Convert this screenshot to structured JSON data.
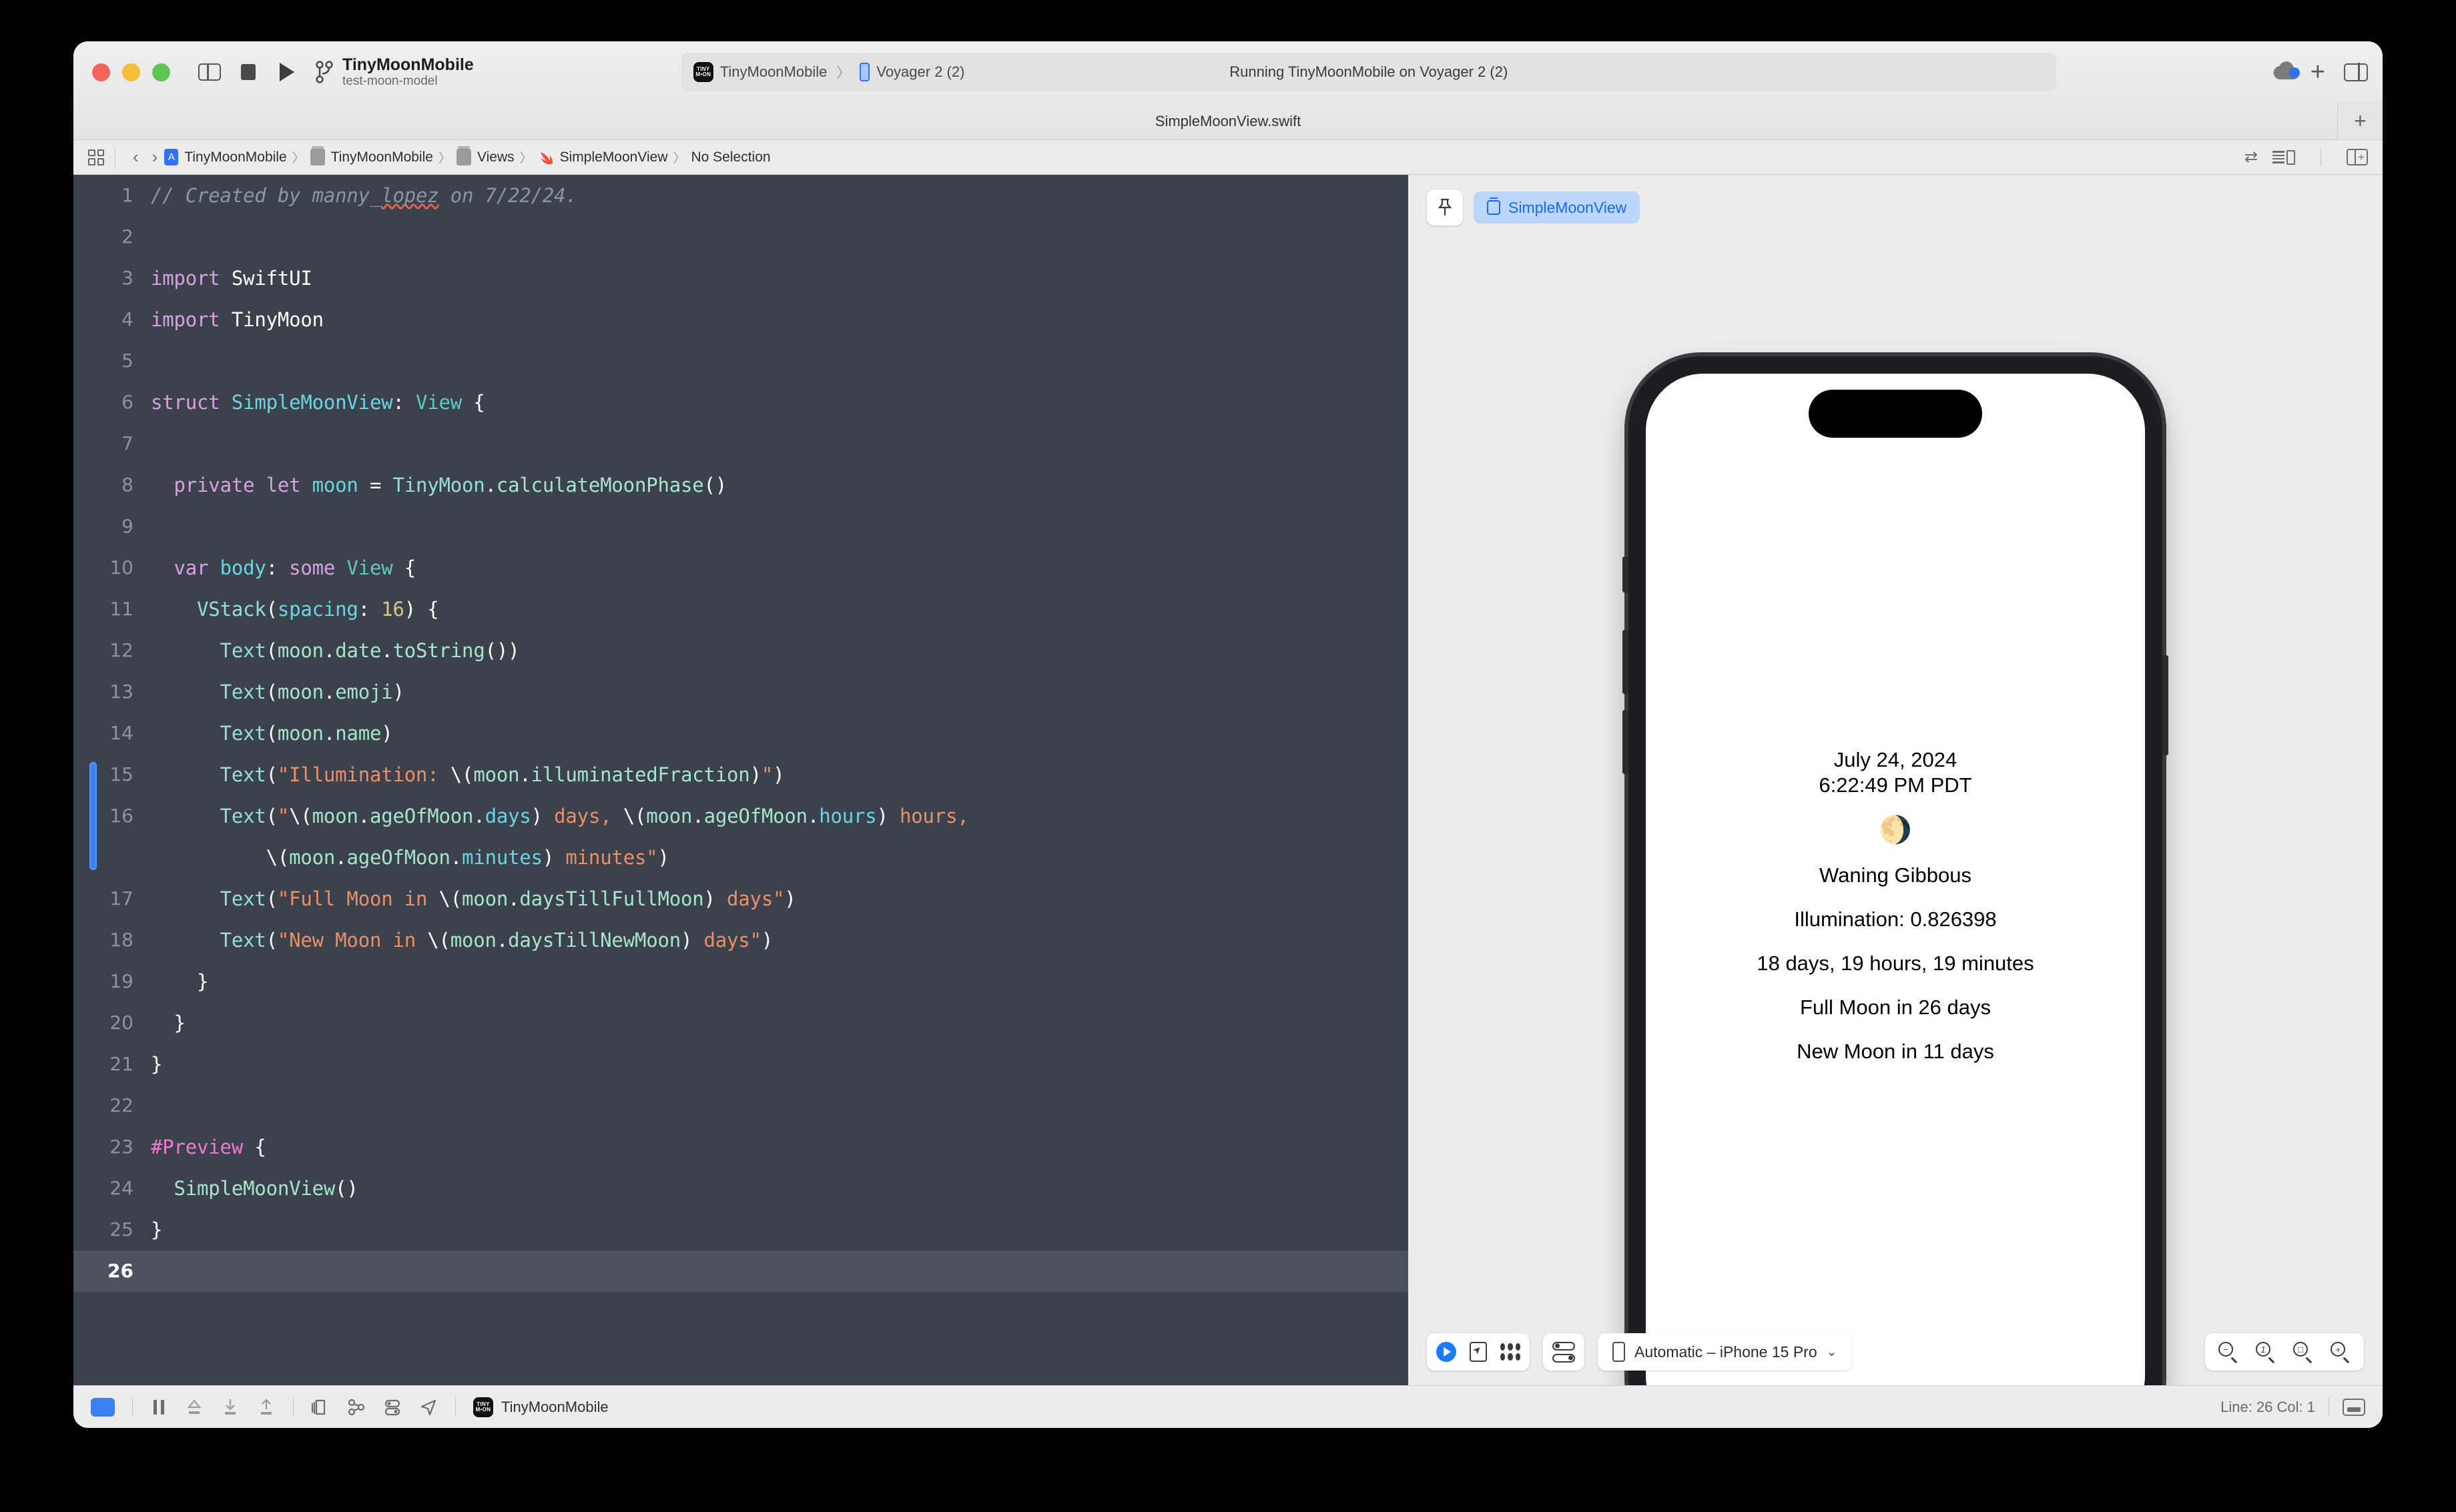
{
  "window": {
    "traffic_lights": [
      "close",
      "minimize",
      "zoom"
    ],
    "scheme": {
      "title": "TinyMoonMobile",
      "subtitle": "test-moon-model"
    },
    "status": {
      "project": "TinyMoonMobile",
      "chevron": "〉",
      "destination": "Voyager 2 (2)",
      "activity": "Running TinyMoonMobile on Voyager 2 (2)",
      "app_icon_line1": "TINY",
      "app_icon_line2": "M•ON"
    },
    "tab": {
      "title": "SimpleMoonView.swift",
      "add_label": "+"
    },
    "toolbar_right": {
      "add_label": "+"
    }
  },
  "breadcrumb": {
    "back": "‹",
    "forward": "›",
    "separator": "〉",
    "items": [
      {
        "label": "TinyMoonMobile",
        "icon": "xcodeproj-icon"
      },
      {
        "label": "TinyMoonMobile",
        "icon": "folder-icon"
      },
      {
        "label": "Views",
        "icon": "folder-icon"
      },
      {
        "label": "SimpleMoonView",
        "icon": "swift-file-icon"
      },
      {
        "label": "No Selection",
        "icon": "none"
      }
    ]
  },
  "editor": {
    "current_line": 26,
    "change_bar_lines": [
      15,
      16
    ],
    "lines": [
      {
        "n": 1,
        "tokens": [
          {
            "t": "// Created by manny_",
            "c": "cm"
          },
          {
            "t": "lopez",
            "c": "cm squig"
          },
          {
            "t": " on 7/22/24.",
            "c": "cm"
          }
        ]
      },
      {
        "n": 2,
        "tokens": []
      },
      {
        "n": 3,
        "tokens": [
          {
            "t": "import ",
            "c": "k"
          },
          {
            "t": "SwiftUI",
            "c": "esc"
          }
        ]
      },
      {
        "n": 4,
        "tokens": [
          {
            "t": "import ",
            "c": "k"
          },
          {
            "t": "TinyMoon",
            "c": "esc"
          }
        ]
      },
      {
        "n": 5,
        "tokens": []
      },
      {
        "n": 6,
        "tokens": [
          {
            "t": "struct ",
            "c": "k"
          },
          {
            "t": "SimpleMoonView",
            "c": "va"
          },
          {
            "t": ": ",
            "c": "esc"
          },
          {
            "t": "View",
            "c": "ty2"
          },
          {
            "t": " {",
            "c": "esc"
          }
        ]
      },
      {
        "n": 7,
        "tokens": []
      },
      {
        "n": 8,
        "tokens": [
          {
            "t": "  ",
            "c": "esc"
          },
          {
            "t": "private let ",
            "c": "k"
          },
          {
            "t": "moon",
            "c": "va"
          },
          {
            "t": " = ",
            "c": "esc"
          },
          {
            "t": "TinyMoon",
            "c": "ty"
          },
          {
            "t": ".",
            "c": "esc"
          },
          {
            "t": "calculateMoonPhase",
            "c": "fn"
          },
          {
            "t": "()",
            "c": "esc"
          }
        ]
      },
      {
        "n": 9,
        "tokens": []
      },
      {
        "n": 10,
        "tokens": [
          {
            "t": "  ",
            "c": "esc"
          },
          {
            "t": "var ",
            "c": "k"
          },
          {
            "t": "body",
            "c": "va"
          },
          {
            "t": ": ",
            "c": "esc"
          },
          {
            "t": "some ",
            "c": "k"
          },
          {
            "t": "View",
            "c": "ty2"
          },
          {
            "t": " {",
            "c": "esc"
          }
        ]
      },
      {
        "n": 11,
        "tokens": [
          {
            "t": "    ",
            "c": "esc"
          },
          {
            "t": "VStack",
            "c": "ty"
          },
          {
            "t": "(",
            "c": "esc"
          },
          {
            "t": "spacing",
            "c": "va"
          },
          {
            "t": ": ",
            "c": "esc"
          },
          {
            "t": "16",
            "c": "nu"
          },
          {
            "t": ") {",
            "c": "esc"
          }
        ]
      },
      {
        "n": 12,
        "tokens": [
          {
            "t": "      ",
            "c": "esc"
          },
          {
            "t": "Text",
            "c": "ty"
          },
          {
            "t": "(",
            "c": "esc"
          },
          {
            "t": "moon",
            "c": "fn"
          },
          {
            "t": ".",
            "c": "esc"
          },
          {
            "t": "date",
            "c": "fn"
          },
          {
            "t": ".",
            "c": "esc"
          },
          {
            "t": "toString",
            "c": "fn"
          },
          {
            "t": "())",
            "c": "esc"
          }
        ]
      },
      {
        "n": 13,
        "tokens": [
          {
            "t": "      ",
            "c": "esc"
          },
          {
            "t": "Text",
            "c": "ty"
          },
          {
            "t": "(",
            "c": "esc"
          },
          {
            "t": "moon",
            "c": "fn"
          },
          {
            "t": ".",
            "c": "esc"
          },
          {
            "t": "emoji",
            "c": "fn"
          },
          {
            "t": ")",
            "c": "esc"
          }
        ]
      },
      {
        "n": 14,
        "tokens": [
          {
            "t": "      ",
            "c": "esc"
          },
          {
            "t": "Text",
            "c": "ty"
          },
          {
            "t": "(",
            "c": "esc"
          },
          {
            "t": "moon",
            "c": "fn"
          },
          {
            "t": ".",
            "c": "esc"
          },
          {
            "t": "name",
            "c": "fn"
          },
          {
            "t": ")",
            "c": "esc"
          }
        ]
      },
      {
        "n": 15,
        "tokens": [
          {
            "t": "      ",
            "c": "esc"
          },
          {
            "t": "Text",
            "c": "ty"
          },
          {
            "t": "(",
            "c": "esc"
          },
          {
            "t": "\"Illumination: ",
            "c": "st"
          },
          {
            "t": "\\(",
            "c": "esc"
          },
          {
            "t": "moon",
            "c": "fn"
          },
          {
            "t": ".",
            "c": "esc"
          },
          {
            "t": "illuminatedFraction",
            "c": "fn"
          },
          {
            "t": ")",
            "c": "esc"
          },
          {
            "t": "\"",
            "c": "st"
          },
          {
            "t": ")",
            "c": "esc"
          }
        ]
      },
      {
        "n": 16,
        "tokens": [
          {
            "t": "      ",
            "c": "esc"
          },
          {
            "t": "Text",
            "c": "ty"
          },
          {
            "t": "(",
            "c": "esc"
          },
          {
            "t": "\"",
            "c": "st"
          },
          {
            "t": "\\(",
            "c": "esc"
          },
          {
            "t": "moon",
            "c": "fn"
          },
          {
            "t": ".",
            "c": "esc"
          },
          {
            "t": "ageOfMoon",
            "c": "fn"
          },
          {
            "t": ".",
            "c": "esc"
          },
          {
            "t": "days",
            "c": "va"
          },
          {
            "t": ")",
            "c": "esc"
          },
          {
            "t": " days, ",
            "c": "st"
          },
          {
            "t": "\\(",
            "c": "esc"
          },
          {
            "t": "moon",
            "c": "fn"
          },
          {
            "t": ".",
            "c": "esc"
          },
          {
            "t": "ageOfMoon",
            "c": "fn"
          },
          {
            "t": ".",
            "c": "esc"
          },
          {
            "t": "hours",
            "c": "va"
          },
          {
            "t": ")",
            "c": "esc"
          },
          {
            "t": " hours,",
            "c": "st"
          }
        ]
      },
      {
        "n": "",
        "tokens": [
          {
            "t": "          ",
            "c": "esc"
          },
          {
            "t": "\\(",
            "c": "esc"
          },
          {
            "t": "moon",
            "c": "fn"
          },
          {
            "t": ".",
            "c": "esc"
          },
          {
            "t": "ageOfMoon",
            "c": "fn"
          },
          {
            "t": ".",
            "c": "esc"
          },
          {
            "t": "minutes",
            "c": "va"
          },
          {
            "t": ")",
            "c": "esc"
          },
          {
            "t": " minutes\"",
            "c": "st"
          },
          {
            "t": ")",
            "c": "esc"
          }
        ]
      },
      {
        "n": 17,
        "tokens": [
          {
            "t": "      ",
            "c": "esc"
          },
          {
            "t": "Text",
            "c": "ty"
          },
          {
            "t": "(",
            "c": "esc"
          },
          {
            "t": "\"Full Moon in ",
            "c": "st"
          },
          {
            "t": "\\(",
            "c": "esc"
          },
          {
            "t": "moon",
            "c": "fn"
          },
          {
            "t": ".",
            "c": "esc"
          },
          {
            "t": "daysTillFullMoon",
            "c": "fn"
          },
          {
            "t": ")",
            "c": "esc"
          },
          {
            "t": " days\"",
            "c": "st"
          },
          {
            "t": ")",
            "c": "esc"
          }
        ]
      },
      {
        "n": 18,
        "tokens": [
          {
            "t": "      ",
            "c": "esc"
          },
          {
            "t": "Text",
            "c": "ty"
          },
          {
            "t": "(",
            "c": "esc"
          },
          {
            "t": "\"New Moon in ",
            "c": "st"
          },
          {
            "t": "\\(",
            "c": "esc"
          },
          {
            "t": "moon",
            "c": "fn"
          },
          {
            "t": ".",
            "c": "esc"
          },
          {
            "t": "daysTillNewMoon",
            "c": "fn"
          },
          {
            "t": ")",
            "c": "esc"
          },
          {
            "t": " days\"",
            "c": "st"
          },
          {
            "t": ")",
            "c": "esc"
          }
        ]
      },
      {
        "n": 19,
        "tokens": [
          {
            "t": "    }",
            "c": "esc"
          }
        ]
      },
      {
        "n": 20,
        "tokens": [
          {
            "t": "  }",
            "c": "esc"
          }
        ]
      },
      {
        "n": 21,
        "tokens": [
          {
            "t": "}",
            "c": "esc"
          }
        ]
      },
      {
        "n": 22,
        "tokens": []
      },
      {
        "n": 23,
        "tokens": [
          {
            "t": "#Preview",
            "c": "pp"
          },
          {
            "t": " {",
            "c": "esc"
          }
        ]
      },
      {
        "n": 24,
        "tokens": [
          {
            "t": "  ",
            "c": "esc"
          },
          {
            "t": "SimpleMoonView",
            "c": "fn"
          },
          {
            "t": "()",
            "c": "esc"
          }
        ]
      },
      {
        "n": 25,
        "tokens": [
          {
            "t": "}",
            "c": "esc"
          }
        ]
      },
      {
        "n": 26,
        "tokens": []
      }
    ]
  },
  "preview": {
    "tab_label": "SimpleMoonView",
    "device_label": "Automatic – iPhone 15 Pro",
    "chevron_down": "⌄",
    "zoom_buttons": [
      "zoom-out",
      "zoom-actual-size",
      "zoom-to-fit",
      "zoom-in"
    ],
    "zoom_actual_label": "1",
    "zoom_out_label": "−",
    "zoom_in_label": "+",
    "zoom_fit_label": "□",
    "app": {
      "date": "July 24, 2024",
      "time": "6:22:49 PM PDT",
      "emoji": "🌖",
      "phase_name": "Waning Gibbous",
      "illumination": "Illumination: 0.826398",
      "age": "18 days, 19 hours, 19 minutes",
      "full_moon": "Full Moon in 26 days",
      "new_moon": "New Moon in 11 days"
    }
  },
  "footer": {
    "project": "TinyMoonMobile",
    "app_icon_line1": "TINY",
    "app_icon_line2": "M•ON",
    "line_col": "Line: 26  Col: 1"
  }
}
